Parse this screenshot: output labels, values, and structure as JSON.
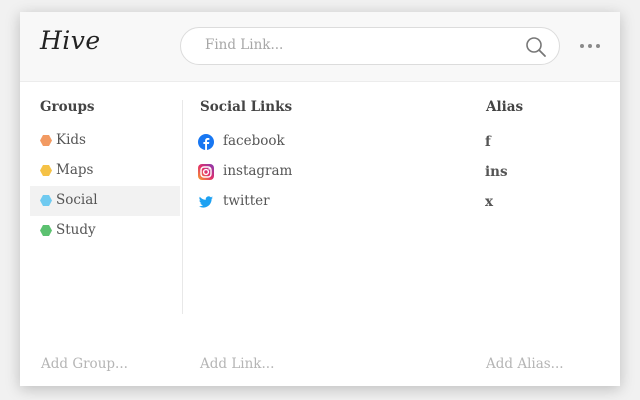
{
  "app": {
    "logo": "Hive"
  },
  "search": {
    "placeholder": "Find Link..."
  },
  "icons": {
    "search": "search-icon",
    "more": "more-dots-icon"
  },
  "groups": {
    "heading": "Groups",
    "items": [
      {
        "label": "Kids",
        "color": "#f29a62"
      },
      {
        "label": "Maps",
        "color": "#f5c246"
      },
      {
        "label": "Social",
        "color": "#6fcaf0",
        "selected": true
      },
      {
        "label": "Study",
        "color": "#5cc170"
      }
    ],
    "add": "Add Group..."
  },
  "links": {
    "heading": "Social Links",
    "items": [
      {
        "label": "facebook",
        "icon": "facebook-icon"
      },
      {
        "label": "instagram",
        "icon": "instagram-icon"
      },
      {
        "label": "twitter",
        "icon": "twitter-icon"
      }
    ],
    "add": "Add Link..."
  },
  "aliases": {
    "heading": "Alias",
    "items": [
      "f",
      "ins",
      "x"
    ],
    "add": "Add Alias..."
  }
}
